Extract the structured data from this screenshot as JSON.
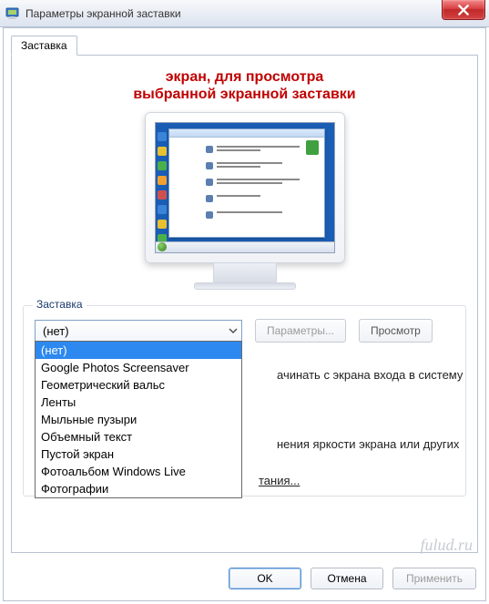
{
  "window": {
    "title": "Параметры экранной заставки"
  },
  "tabs": {
    "main": "Заставка"
  },
  "annotation": {
    "line1": "экран, для просмотра",
    "line2": "выбранной экранной заставки"
  },
  "group": {
    "legend": "Заставка",
    "combo_selected": "(нет)",
    "btn_params": "Параметры...",
    "btn_preview": "Просмотр",
    "options": [
      "(нет)",
      "Google Photos Screensaver",
      "Геометрический вальс",
      "Ленты",
      "Мыльные пузыри",
      "Объемный текст",
      "Пустой экран",
      "Фотоальбом Windows Live",
      "Фотографии"
    ],
    "selected_index": 0,
    "checkbox_text_partial": "ачинать с экрана входа в систему"
  },
  "power": {
    "text_partial": "нения яркости экрана или других",
    "link_partial": "тания..."
  },
  "footer": {
    "ok": "OK",
    "cancel": "Отмена",
    "apply": "Применить"
  },
  "watermark": "fulud.ru"
}
